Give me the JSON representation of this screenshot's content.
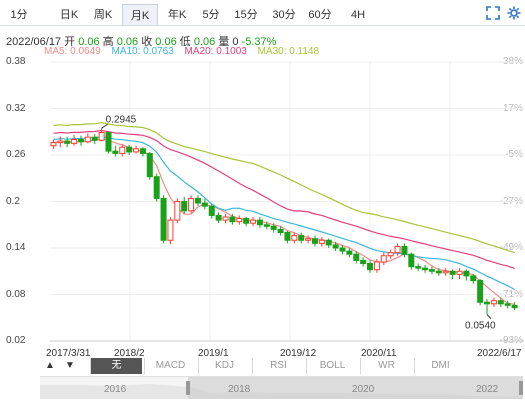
{
  "tabs": [
    {
      "label": "1分"
    },
    {
      "label": "日K"
    },
    {
      "label": "周K"
    },
    {
      "label": "月K",
      "active": true
    },
    {
      "label": "年K"
    },
    {
      "label": "5分"
    },
    {
      "label": "15分"
    },
    {
      "label": "30分"
    },
    {
      "label": "60分"
    },
    {
      "label": "4H"
    }
  ],
  "tools": {
    "expand": "expand-icon",
    "settings": "gear-icon"
  },
  "info": {
    "date": "2022/06/17",
    "open_label": "开",
    "open": "0.06",
    "high_label": "高",
    "high": "0.06",
    "close_label": "收",
    "close": "0.06",
    "low_label": "低",
    "low": "0.06",
    "volume_label": "量",
    "volume": "0",
    "change": "-5.37%"
  },
  "ma": {
    "ma5": "MA5: 0.0649",
    "ma10": "MA10: 0.0763",
    "ma20": "MA20: 0.1003",
    "ma30": "MA30: 0.1148"
  },
  "colors": {
    "up": "#ff3b30",
    "down": "#1aa11a",
    "ma5": "#f08c8c",
    "ma10": "#3ab8d6",
    "ma20": "#e23f7f",
    "ma30": "#a8c43a",
    "grid": "#eeeeee"
  },
  "chart_data": {
    "type": "candlestick",
    "y_ticks": [
      "0.38",
      "0.32",
      "0.26",
      "0.2",
      "0.14",
      "0.08",
      "0.02"
    ],
    "pct_ticks": [
      "38%",
      "17%",
      "-5%",
      "-27%",
      "-49%",
      "-71%",
      "-93%"
    ],
    "x_labels": [
      "2017/3/31",
      "2018/2",
      "2019/1",
      "2019/12",
      "2020/11",
      "2022/6/17"
    ],
    "ylim": [
      0.02,
      0.38
    ],
    "annotations": {
      "high": "0.2945",
      "low": "0.0540"
    },
    "high_index": 7,
    "low_index": 63,
    "candles": [
      [
        0.272,
        0.276,
        0.28,
        0.268
      ],
      [
        0.276,
        0.278,
        0.284,
        0.27
      ],
      [
        0.278,
        0.275,
        0.283,
        0.27
      ],
      [
        0.275,
        0.28,
        0.286,
        0.272
      ],
      [
        0.28,
        0.277,
        0.285,
        0.272
      ],
      [
        0.277,
        0.283,
        0.288,
        0.275
      ],
      [
        0.283,
        0.279,
        0.287,
        0.274
      ],
      [
        0.279,
        0.289,
        0.2945,
        0.278
      ],
      [
        0.289,
        0.265,
        0.29,
        0.262
      ],
      [
        0.265,
        0.262,
        0.272,
        0.258
      ],
      [
        0.262,
        0.27,
        0.274,
        0.258
      ],
      [
        0.27,
        0.264,
        0.273,
        0.26
      ],
      [
        0.264,
        0.268,
        0.272,
        0.262
      ],
      [
        0.268,
        0.262,
        0.27,
        0.258
      ],
      [
        0.262,
        0.232,
        0.264,
        0.228
      ],
      [
        0.232,
        0.204,
        0.236,
        0.2
      ],
      [
        0.204,
        0.15,
        0.208,
        0.146
      ],
      [
        0.15,
        0.176,
        0.18,
        0.145
      ],
      [
        0.176,
        0.2,
        0.204,
        0.172
      ],
      [
        0.2,
        0.188,
        0.206,
        0.184
      ],
      [
        0.188,
        0.204,
        0.208,
        0.185
      ],
      [
        0.204,
        0.198,
        0.208,
        0.194
      ],
      [
        0.198,
        0.194,
        0.204,
        0.19
      ],
      [
        0.194,
        0.182,
        0.196,
        0.178
      ],
      [
        0.182,
        0.176,
        0.186,
        0.172
      ],
      [
        0.176,
        0.18,
        0.184,
        0.172
      ],
      [
        0.18,
        0.174,
        0.184,
        0.17
      ],
      [
        0.174,
        0.178,
        0.182,
        0.17
      ],
      [
        0.178,
        0.172,
        0.18,
        0.168
      ],
      [
        0.172,
        0.176,
        0.18,
        0.168
      ],
      [
        0.176,
        0.17,
        0.18,
        0.166
      ],
      [
        0.17,
        0.168,
        0.174,
        0.164
      ],
      [
        0.168,
        0.164,
        0.172,
        0.16
      ],
      [
        0.164,
        0.16,
        0.168,
        0.156
      ],
      [
        0.16,
        0.15,
        0.162,
        0.146
      ],
      [
        0.15,
        0.156,
        0.16,
        0.146
      ],
      [
        0.156,
        0.15,
        0.16,
        0.146
      ],
      [
        0.15,
        0.152,
        0.156,
        0.146
      ],
      [
        0.152,
        0.146,
        0.156,
        0.142
      ],
      [
        0.146,
        0.15,
        0.154,
        0.142
      ],
      [
        0.15,
        0.144,
        0.152,
        0.14
      ],
      [
        0.144,
        0.14,
        0.148,
        0.136
      ],
      [
        0.14,
        0.136,
        0.144,
        0.132
      ],
      [
        0.136,
        0.132,
        0.14,
        0.128
      ],
      [
        0.132,
        0.124,
        0.136,
        0.12
      ],
      [
        0.124,
        0.12,
        0.128,
        0.116
      ],
      [
        0.12,
        0.112,
        0.124,
        0.108
      ],
      [
        0.112,
        0.122,
        0.126,
        0.108
      ],
      [
        0.122,
        0.13,
        0.134,
        0.118
      ],
      [
        0.13,
        0.134,
        0.138,
        0.126
      ],
      [
        0.134,
        0.142,
        0.146,
        0.13
      ],
      [
        0.142,
        0.132,
        0.146,
        0.128
      ],
      [
        0.132,
        0.116,
        0.134,
        0.112
      ],
      [
        0.116,
        0.114,
        0.12,
        0.11
      ],
      [
        0.114,
        0.112,
        0.118,
        0.108
      ],
      [
        0.112,
        0.11,
        0.116,
        0.106
      ],
      [
        0.11,
        0.108,
        0.114,
        0.104
      ],
      [
        0.108,
        0.11,
        0.114,
        0.104
      ],
      [
        0.11,
        0.106,
        0.112,
        0.1
      ],
      [
        0.106,
        0.11,
        0.114,
        0.1
      ],
      [
        0.11,
        0.104,
        0.112,
        0.098
      ],
      [
        0.104,
        0.098,
        0.106,
        0.094
      ],
      [
        0.098,
        0.07,
        0.1,
        0.066
      ],
      [
        0.07,
        0.068,
        0.074,
        0.054
      ],
      [
        0.068,
        0.072,
        0.076,
        0.064
      ],
      [
        0.072,
        0.068,
        0.076,
        0.064
      ],
      [
        0.068,
        0.066,
        0.072,
        0.062
      ],
      [
        0.066,
        0.063,
        0.07,
        0.06
      ]
    ]
  },
  "nav": {
    "prev": "▲",
    "next": "▼",
    "indicators": [
      "无",
      "MACD",
      "KDJ",
      "RSI",
      "BOLL",
      "WR",
      "DMI"
    ]
  },
  "range": {
    "years": [
      "2016",
      "2018",
      "2020",
      "2022"
    ]
  }
}
